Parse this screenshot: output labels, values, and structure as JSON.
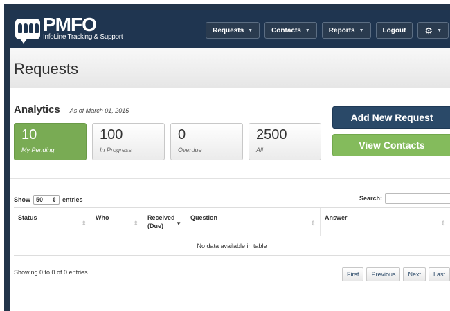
{
  "brand": {
    "name": "PMFO",
    "tagline": "InfoLine Tracking & Support"
  },
  "nav": {
    "items": [
      {
        "label": "Requests",
        "has_caret": true
      },
      {
        "label": "Contacts",
        "has_caret": true
      },
      {
        "label": "Reports",
        "has_caret": true
      },
      {
        "label": "Logout",
        "has_caret": false
      }
    ],
    "settings_icon": "gear-icon"
  },
  "page": {
    "title": "Requests"
  },
  "analytics": {
    "title": "Analytics",
    "as_of": "As of March 01, 2015",
    "stats": [
      {
        "value": "10",
        "label": "My Pending"
      },
      {
        "value": "100",
        "label": "In Progress"
      },
      {
        "value": "0",
        "label": "Overdue"
      },
      {
        "value": "2500",
        "label": "All"
      }
    ]
  },
  "actions": {
    "add_request": "Add New Request",
    "view_contacts": "View Contacts"
  },
  "table_controls": {
    "show_prefix": "Show",
    "page_size": "50",
    "show_suffix": "entries",
    "search_label": "Search:",
    "search_value": ""
  },
  "table": {
    "columns": [
      "Status",
      "Who",
      "Received (Due)",
      "Question",
      "Answer"
    ],
    "empty_message": "No data available in table",
    "info": "Showing 0 to 0 of 0 entries"
  },
  "pagination": [
    "First",
    "Previous",
    "Next",
    "Last"
  ],
  "colors": {
    "navbar": "#1f3550",
    "primary_button": "#2a4968",
    "success_button": "#84bb5c",
    "pending_tile": "#79ab54"
  }
}
